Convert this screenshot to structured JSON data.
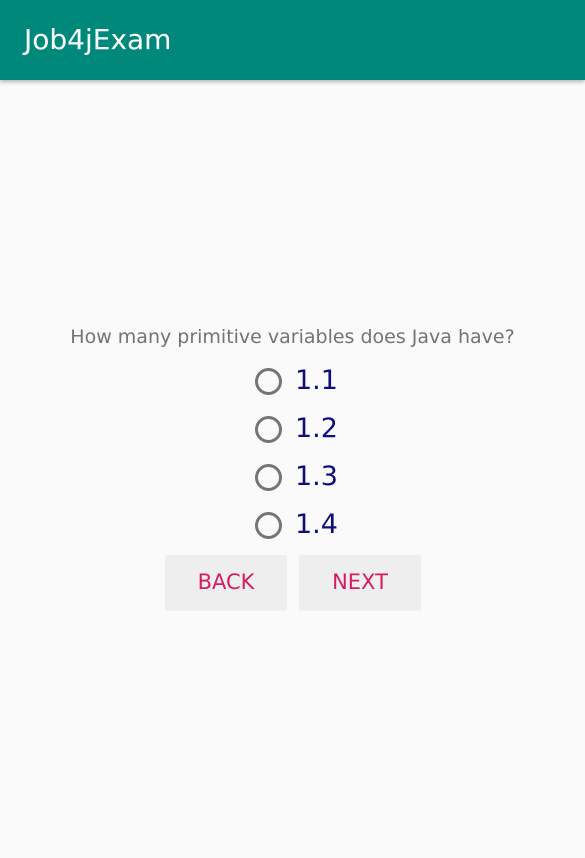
{
  "app_bar": {
    "title": "Job4jExam",
    "color": "#00897b"
  },
  "question": {
    "text": "How many primitive variables does Java have?"
  },
  "options": [
    {
      "label": "1.1",
      "selected": false
    },
    {
      "label": "1.2",
      "selected": false
    },
    {
      "label": "1.3",
      "selected": false
    },
    {
      "label": "1.4",
      "selected": false
    }
  ],
  "buttons": {
    "back_label": "BACK",
    "next_label": "NEXT",
    "text_color": "#d81b60"
  }
}
